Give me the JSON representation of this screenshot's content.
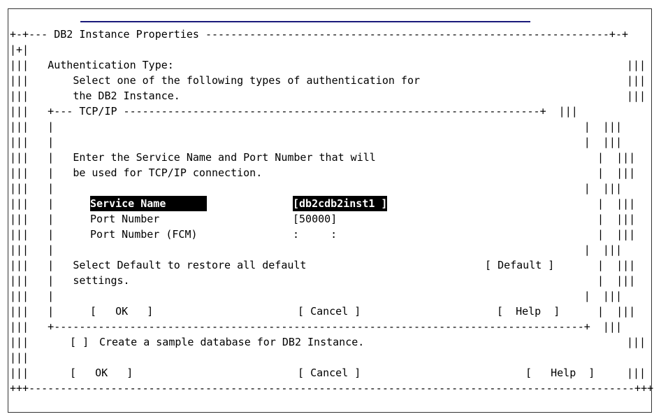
{
  "dialog": {
    "title": "DB2 Instance Properties",
    "auth_heading": "Authentication Type:",
    "auth_desc_1": "Select one of the following types of authentication for",
    "auth_desc_2": "the DB2 Instance."
  },
  "tcpip": {
    "title": "TCP/IP",
    "desc_1": "Enter the Service Name and Port Number that will",
    "desc_2": "be used for TCP/IP connection.",
    "service_name_label": "Service Name",
    "service_name_value": "db2cdb2inst1",
    "port_number_label": "Port Number",
    "port_number_value": "50000",
    "port_fcm_label": "Port Number (FCM)",
    "port_fcm_value": ":     :",
    "default_desc_1": "Select Default to restore all default",
    "default_desc_2": "settings.",
    "default_button": "Default",
    "ok_button": "OK",
    "cancel_button": "Cancel",
    "help_button": "Help"
  },
  "sample_db": {
    "checkbox_state": " ",
    "label": "Create a sample database for DB2 Instance."
  },
  "footer": {
    "ok_button": "OK",
    "cancel_button": "Cancel",
    "help_button": "Help"
  }
}
